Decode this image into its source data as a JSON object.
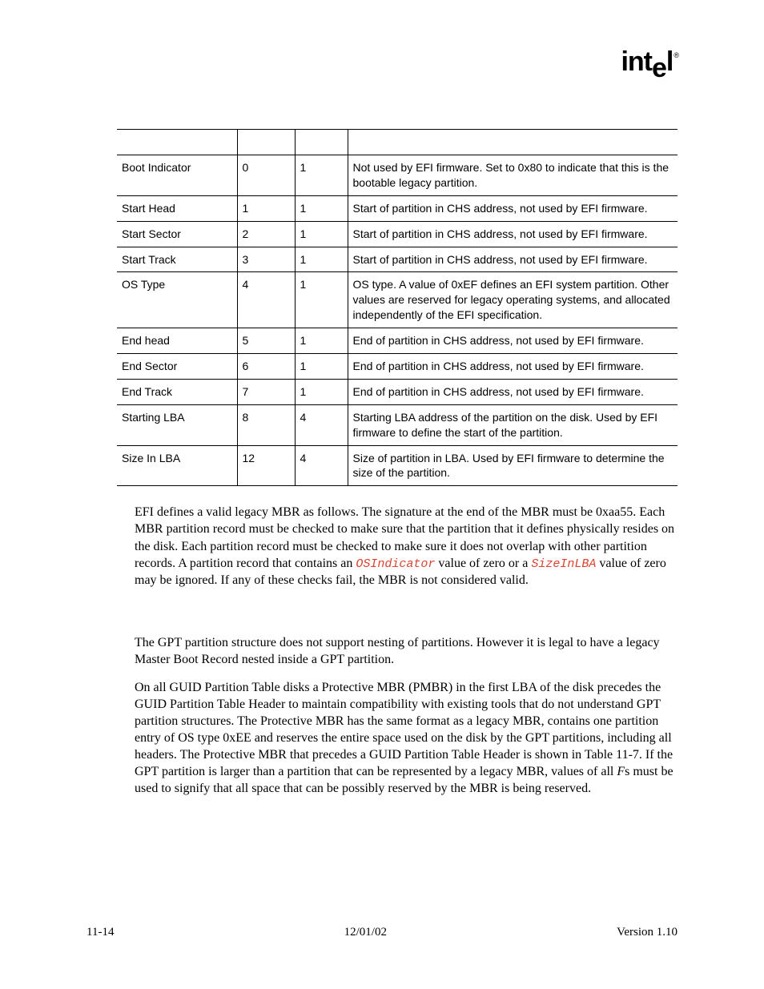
{
  "logo": {
    "text_a": "int",
    "text_b": "e",
    "text_c": "l",
    "reg": "®"
  },
  "table": {
    "rows": [
      {
        "name": "Boot Indicator",
        "off": "0",
        "len": "1",
        "desc": "Not used by EFI firmware. Set to 0x80 to indicate that this is the bootable legacy partition."
      },
      {
        "name": "Start Head",
        "off": "1",
        "len": "1",
        "desc": "Start of partition in CHS address, not used by EFI firmware."
      },
      {
        "name": "Start Sector",
        "off": "2",
        "len": "1",
        "desc": "Start of partition in CHS address, not used by EFI firmware."
      },
      {
        "name": "Start Track",
        "off": "3",
        "len": "1",
        "desc": "Start of partition in CHS address, not used by EFI firmware."
      },
      {
        "name": "OS Type",
        "off": "4",
        "len": "1",
        "desc": "OS type.  A value of 0xEF defines an EFI system partition.  Other values are reserved for legacy operating systems, and allocated independently of the EFI specification."
      },
      {
        "name": "End head",
        "off": "5",
        "len": "1",
        "desc": "End of partition in CHS address, not used by EFI firmware."
      },
      {
        "name": "End Sector",
        "off": "6",
        "len": "1",
        "desc": "End of partition in CHS address, not used by EFI firmware."
      },
      {
        "name": "End Track",
        "off": "7",
        "len": "1",
        "desc": "End of partition in CHS address, not used by EFI firmware."
      },
      {
        "name": "Starting LBA",
        "off": "8",
        "len": "4",
        "desc": "Starting LBA address of the partition on the disk.  Used by EFI firmware to define the start of the partition."
      },
      {
        "name": "Size In LBA",
        "off": "12",
        "len": "4",
        "desc": "Size of partition in LBA.  Used by EFI firmware to determine the size of the partition."
      }
    ]
  },
  "para1": {
    "a": "EFI defines a valid legacy MBR as follows.  The signature at the end of the MBR must be 0xaa55.  Each MBR partition record must be checked to make sure that the partition that it defines physically resides on the disk.  Each partition record must be checked to make sure it does not overlap with other partition records.  A partition record that contains an ",
    "code1": "OSIndicator",
    "b": " value of zero or a ",
    "code2": "SizeInLBA",
    "c": " value of zero may be ignored.  If any of these checks fail, the MBR is not considered valid."
  },
  "para2": "The GPT partition structure does not support nesting of partitions.  However it is legal to have a legacy Master Boot Record nested inside a GPT partition.",
  "para3": {
    "a": "On all GUID Partition Table disks a Protective MBR (PMBR) in the first LBA of the disk precedes the GUID Partition Table Header to maintain compatibility with existing tools that do not understand GPT partition structures.  The Protective MBR has the same format as a legacy MBR, contains one partition entry of OS type 0xEE and reserves the entire space used on the disk by the GPT partitions, including all headers.  The Protective MBR that precedes a GUID Partition Table Header is shown in Table 11-7.  If the GPT partition is larger than a partition that can be represented by a legacy MBR, values of all ",
    "ital": "F",
    "b": "s must be used to signify that all space that can be possibly reserved by the MBR is being reserved."
  },
  "footer": {
    "left": "11-14",
    "center": "12/01/02",
    "right": "Version 1.10"
  }
}
